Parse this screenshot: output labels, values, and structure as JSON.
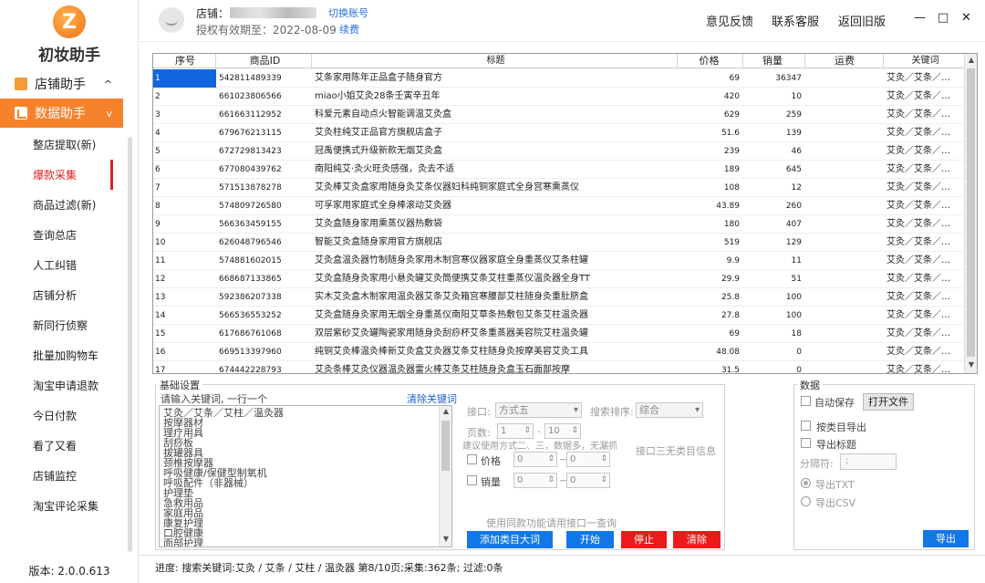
{
  "sidebar": {
    "logo_letter": "Z",
    "brand": "初妆助手",
    "groups": [
      {
        "label": "店铺助手",
        "caret": "^"
      },
      {
        "label": "数据助手",
        "caret": "v"
      }
    ],
    "items": [
      "整店提取(新)",
      "爆款采集",
      "商品过滤(新)",
      "查询总店",
      "人工纠错",
      "店铺分析",
      "新同行侦察",
      "批量加购物车",
      "淘宝申请退款",
      "今日付款",
      "看了又看",
      "店铺监控",
      "淘宝评论采集"
    ],
    "version": "版本: 2.0.0.613"
  },
  "header": {
    "shop_label": "店铺：",
    "switch_account": "切换账号",
    "expire": "授权有效期至：2022-08-09",
    "renew": "续费",
    "links": [
      "意见反馈",
      "联系客服",
      "返回旧版"
    ],
    "win": [
      "—",
      "□",
      "✕"
    ]
  },
  "grid": {
    "columns": [
      "序号",
      "商品ID",
      "标题",
      "价格",
      "销量",
      "运费",
      "关键词"
    ],
    "rows": [
      [
        "1",
        "542811489339",
        "艾条家用陈年正品盒子随身官方",
        "69",
        "36347",
        "",
        "艾灸／艾条／…"
      ],
      [
        "2",
        "661023806566",
        "miao小姐艾灸28条壬寅辛丑年",
        "420",
        "10",
        "",
        "艾灸／艾条／…"
      ],
      [
        "3",
        "661663112952",
        "科爱元素自动点火智能调温艾灸盒",
        "629",
        "259",
        "",
        "艾灸／艾条／…"
      ],
      [
        "4",
        "679676213115",
        "艾灸柱纯艾正品官方旗舰店盒子",
        "51.6",
        "139",
        "",
        "艾灸／艾条／…"
      ],
      [
        "5",
        "672729813423",
        "冠禹便携式升级新款无烟艾灸盒",
        "239",
        "46",
        "",
        "艾灸／艾条／…"
      ],
      [
        "6",
        "677080439762",
        "南阳纯艾·灸火旺灸感强，灸去不适",
        "189",
        "645",
        "",
        "艾灸／艾条／…"
      ],
      [
        "7",
        "571513878278",
        "艾灸棒艾灸盒家用随身灸艾条仪器妇科纯铜家庭式全身宫寒熏蒸仪",
        "108",
        "12",
        "",
        "艾灸／艾条／…"
      ],
      [
        "8",
        "574809726580",
        "可孚家用家庭式全身棒滚动艾灸器",
        "43.89",
        "260",
        "",
        "艾灸／艾条／…"
      ],
      [
        "9",
        "566363459155",
        "艾灸盒随身家用熏蒸仪器热敷袋",
        "180",
        "407",
        "",
        "艾灸／艾条／…"
      ],
      [
        "10",
        "626048796546",
        "智能艾灸盒随身家用官方旗舰店",
        "519",
        "129",
        "",
        "艾灸／艾条／…"
      ],
      [
        "11",
        "574881602015",
        "艾灸盒温灸器竹制随身灸家用木制宫寒仪器家庭全身重蒸仪艾条柱罐",
        "9.9",
        "11",
        "",
        "艾灸／艾条／…"
      ],
      [
        "12",
        "668687133865",
        "艾灸盒随身灸家用小悬灸罐艾灸筒便携艾条艾柱重蒸仪温灸器全身TT",
        "29.9",
        "51",
        "",
        "艾灸／艾条／…"
      ],
      [
        "13",
        "592386207338",
        "实木艾灸盒木制家用温灸器艾条艾灸箱宫寒腰部艾柱随身灸重肚脐盒",
        "25.8",
        "100",
        "",
        "艾灸／艾条／…"
      ],
      [
        "14",
        "566536553252",
        "艾灸盒随身灸家用无烟全身重蒸仪南阳艾草条热敷包艾条艾柱温灸器",
        "27.8",
        "100",
        "",
        "艾灸／艾条／…"
      ],
      [
        "15",
        "617686761068",
        "双层紫砂艾灸罐陶瓷家用随身灸刮痧杯艾条重蒸器美容院艾柱温灸罐",
        "69",
        "18",
        "",
        "艾灸／艾条／…"
      ],
      [
        "16",
        "669513397960",
        "纯铜艾灸棒温灸棒新艾灸盒艾灸器艾条艾柱随身灸按摩美容艾灸工具",
        "48.08",
        "0",
        "",
        "艾灸／艾条／…"
      ],
      [
        "17",
        "674442228793",
        "艾灸条棒艾灸仪器温灸器雷火棒艾条艾柱随身灸盒玉石面部按摩",
        "31.5",
        "0",
        "",
        "艾灸／艾条／…"
      ]
    ]
  },
  "basic": {
    "legend": "基础设置",
    "hint": "请输入关键词, 一行一个",
    "clear_kw": "清除关键词",
    "keywords": [
      "艾灸／艾条／艾柱／温灸器",
      "按摩器材",
      "理疗用具",
      "刮痧板",
      "拔罐器具",
      "颈椎按摩器",
      "呼吸健康/保健型制氧机",
      "呼吸配件（非器械）",
      "护理垫",
      "急救用品",
      "家庭用品",
      "康复护理",
      "口腔健康",
      "面部护理"
    ],
    "port_label": "接口:",
    "port_value": "方式五",
    "sort_label": "搜索排序:",
    "sort_value": "综合",
    "pages_label": "页数:",
    "page_from": "1",
    "page_to": "10",
    "pages_hint": "建议使用方式二、三，数据多，无漏抓",
    "port3_note": "接口三无类目信息",
    "price_label": "价格",
    "sales_label": "销量",
    "price_from": "0",
    "price_to": "0",
    "sales_from": "0",
    "sales_to": "0",
    "tilde": "~",
    "same_style_note": "使用同款功能请用接口一查询",
    "btn_add_cat": "添加类目大词",
    "btn_start": "开始",
    "btn_stop": "停止",
    "btn_clear": "清除"
  },
  "datapanel": {
    "legend": "数据",
    "auto_save": "自动保存",
    "open_file": "打开文件",
    "by_cat": "按类目导出",
    "export_title": "导出标题",
    "sep_label": "分隔符:",
    "sep_value": ";",
    "txt": "导出TXT",
    "csv": "导出CSV",
    "export": "导出"
  },
  "status": "进度: 搜索关键词:艾灸 / 艾条 / 艾柱 / 温灸器 第8/10页;采集:362条; 过滤:0条",
  "colors": {
    "accent": "#f7822c",
    "active_red": "#e02020",
    "blue": "#1277e8",
    "red": "#ee1a1a"
  }
}
